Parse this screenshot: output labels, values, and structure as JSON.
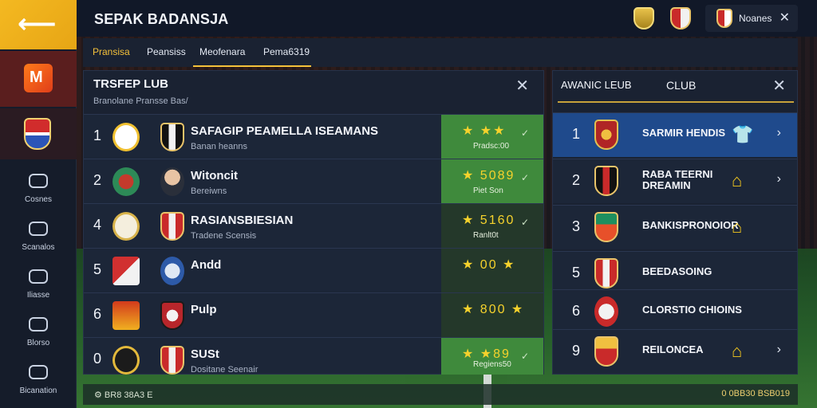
{
  "header": {
    "title": "SEPAK BADANSJA",
    "notification_text": "Noanes"
  },
  "tabs": [
    "Pransisa",
    "Peansiss",
    "Meofenara",
    "Pema6319"
  ],
  "sidebar": {
    "items": [
      {
        "label": "Cosnes"
      },
      {
        "label": "Scanalos"
      },
      {
        "label": "Iliasse"
      },
      {
        "label": "Blorso"
      },
      {
        "label": "Bicanation"
      }
    ]
  },
  "left_panel": {
    "title": "TRSFEP LUB",
    "subtitle": "Branolane Pransse Bas/",
    "rows": [
      {
        "rank": "1",
        "name": "SAFAGIP PEAMELLA ISEAMANS",
        "sub": "Banan heanns",
        "stars": "★ ★★",
        "value": "Pradsc:00",
        "check": "✓",
        "rating_dark": false
      },
      {
        "rank": "2",
        "name": "Witoncit",
        "sub": "Bereiwns",
        "stars": "★ 5089",
        "value": "Piet Son",
        "check": "✓",
        "rating_dark": false
      },
      {
        "rank": "4",
        "name": "RASIANSBIESIAN",
        "sub": "Tradene Scensis",
        "stars": "★ 5160",
        "value": "Ranlt0t",
        "check": "✓",
        "rating_dark": true
      },
      {
        "rank": "5",
        "name": "Andd",
        "sub": "",
        "stars": "★ 00 ★",
        "value": "",
        "check": "",
        "rating_dark": true
      },
      {
        "rank": "6",
        "name": "Pulp",
        "sub": "",
        "stars": "★ 800 ★",
        "value": "",
        "check": "",
        "rating_dark": true
      },
      {
        "rank": "0",
        "name": "SUSt",
        "sub": "Dositane Seenair",
        "stars": "★ ★89",
        "value": "Regiens50",
        "check": "✓",
        "rating_dark": false
      }
    ]
  },
  "right_panel": {
    "title_left": "AWANIC LEUB",
    "title_right": "CLUB",
    "rows": [
      {
        "rank": "1",
        "name": "SARMIR HENDIS",
        "icon": "shirt-icon",
        "selected": true
      },
      {
        "rank": "2",
        "name": "RABA TEERNI\nDREAMIN",
        "icon": "house-icon",
        "selected": false
      },
      {
        "rank": "3",
        "name": "BANKISPRONOIOR",
        "icon": "house-icon",
        "selected": false
      },
      {
        "rank": "5",
        "name": "BEEDASOING",
        "icon": "",
        "selected": false
      },
      {
        "rank": "6",
        "name": "CLORSTIO CHIOINS",
        "icon": "",
        "selected": false
      },
      {
        "rank": "9",
        "name": "REILONCEA",
        "icon": "house-icon",
        "selected": false
      }
    ]
  },
  "footer": {
    "left_text": "⚙ BR8 38A3 E",
    "right_text": "0 0BB30 BSB019"
  },
  "colors": {
    "accent": "#f4c13a",
    "rating_green": "#3f8a3c",
    "selected_blue": "#1f4a8c"
  }
}
